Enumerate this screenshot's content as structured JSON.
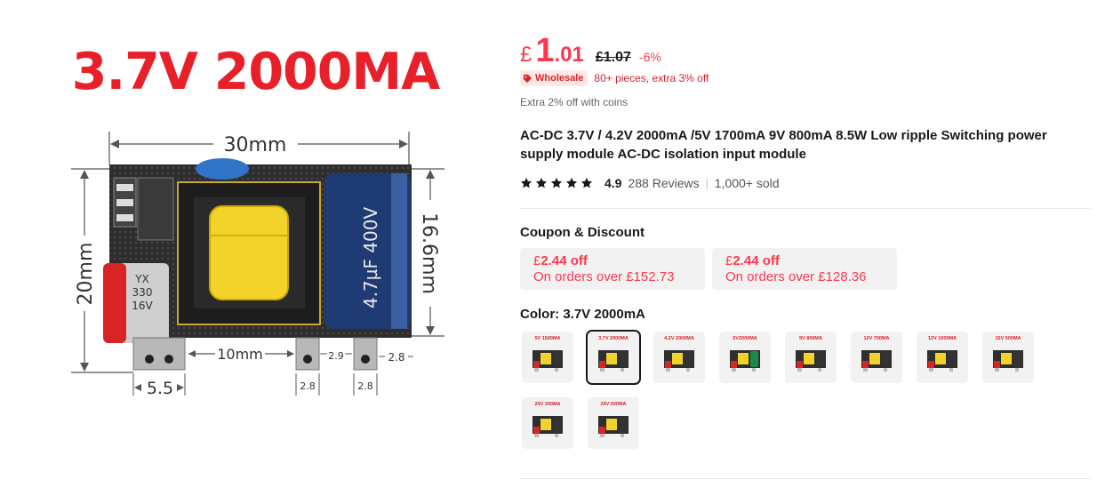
{
  "image": {
    "headline": "3.7V 2000MA",
    "dimensions": {
      "width_top": "30mm",
      "height_left": "20mm",
      "height_right": "16.6mm",
      "pin_gap": "10mm",
      "pin_left": "5.5",
      "pin_small_a": "2.9",
      "pin_small_b": "2.8",
      "pin_small_c": "2.8",
      "pin_small_d": "2.8"
    },
    "component_labels": {
      "cap_small_1": "YX",
      "cap_small_2": "330",
      "cap_small_3": "16V",
      "cap_big": "4.7µF 400V"
    }
  },
  "price": {
    "currency": "£",
    "integer": "1",
    "decimal": ".01",
    "original": "£1.07",
    "discount": "-6%"
  },
  "wholesale": {
    "badge": "Wholesale",
    "text": "80+ pieces, extra 3% off"
  },
  "coins_text": "Extra 2% off with coins",
  "title": "AC-DC 3.7V / 4.2V 2000mA /5V 1700mA 9V 800mA 8.5W Low ripple Switching power supply module AC-DC isolation input module",
  "rating": {
    "stars": 5,
    "score": "4.9",
    "reviews": "288 Reviews",
    "separator": "|",
    "sold": "1,000+ sold"
  },
  "coupon_section": {
    "title": "Coupon & Discount",
    "coupons": [
      {
        "currency": "£",
        "amount": "2.44 off",
        "condition": "On orders over £152.73"
      },
      {
        "currency": "£",
        "amount": "2.44 off",
        "condition": "On orders over £128.36"
      }
    ]
  },
  "color_section": {
    "title": "Color: 3.7V 2000mA",
    "options": [
      {
        "label": "5V 1500MA",
        "selected": false,
        "cap": "#333"
      },
      {
        "label": "3.7V 2000MA",
        "selected": true,
        "cap": "#333"
      },
      {
        "label": "4.2V 2000MA",
        "selected": false,
        "cap": "#333"
      },
      {
        "label": "5V2000MA",
        "selected": false,
        "cap": "#1a8a4a"
      },
      {
        "label": "9V 800MA",
        "selected": false,
        "cap": "#333"
      },
      {
        "label": "12V 700MA",
        "selected": false,
        "cap": "#333"
      },
      {
        "label": "12V 1000MA",
        "selected": false,
        "cap": "#333"
      },
      {
        "label": "15V 500MA",
        "selected": false,
        "cap": "#333"
      },
      {
        "label": "24V 300MA",
        "selected": false,
        "cap": "#333"
      },
      {
        "label": "24V 500MA",
        "selected": false,
        "cap": "#333"
      }
    ]
  },
  "colors": {
    "accent_red": "#fd384f",
    "text_dark": "#191919",
    "headline_red": "#e8202a"
  }
}
